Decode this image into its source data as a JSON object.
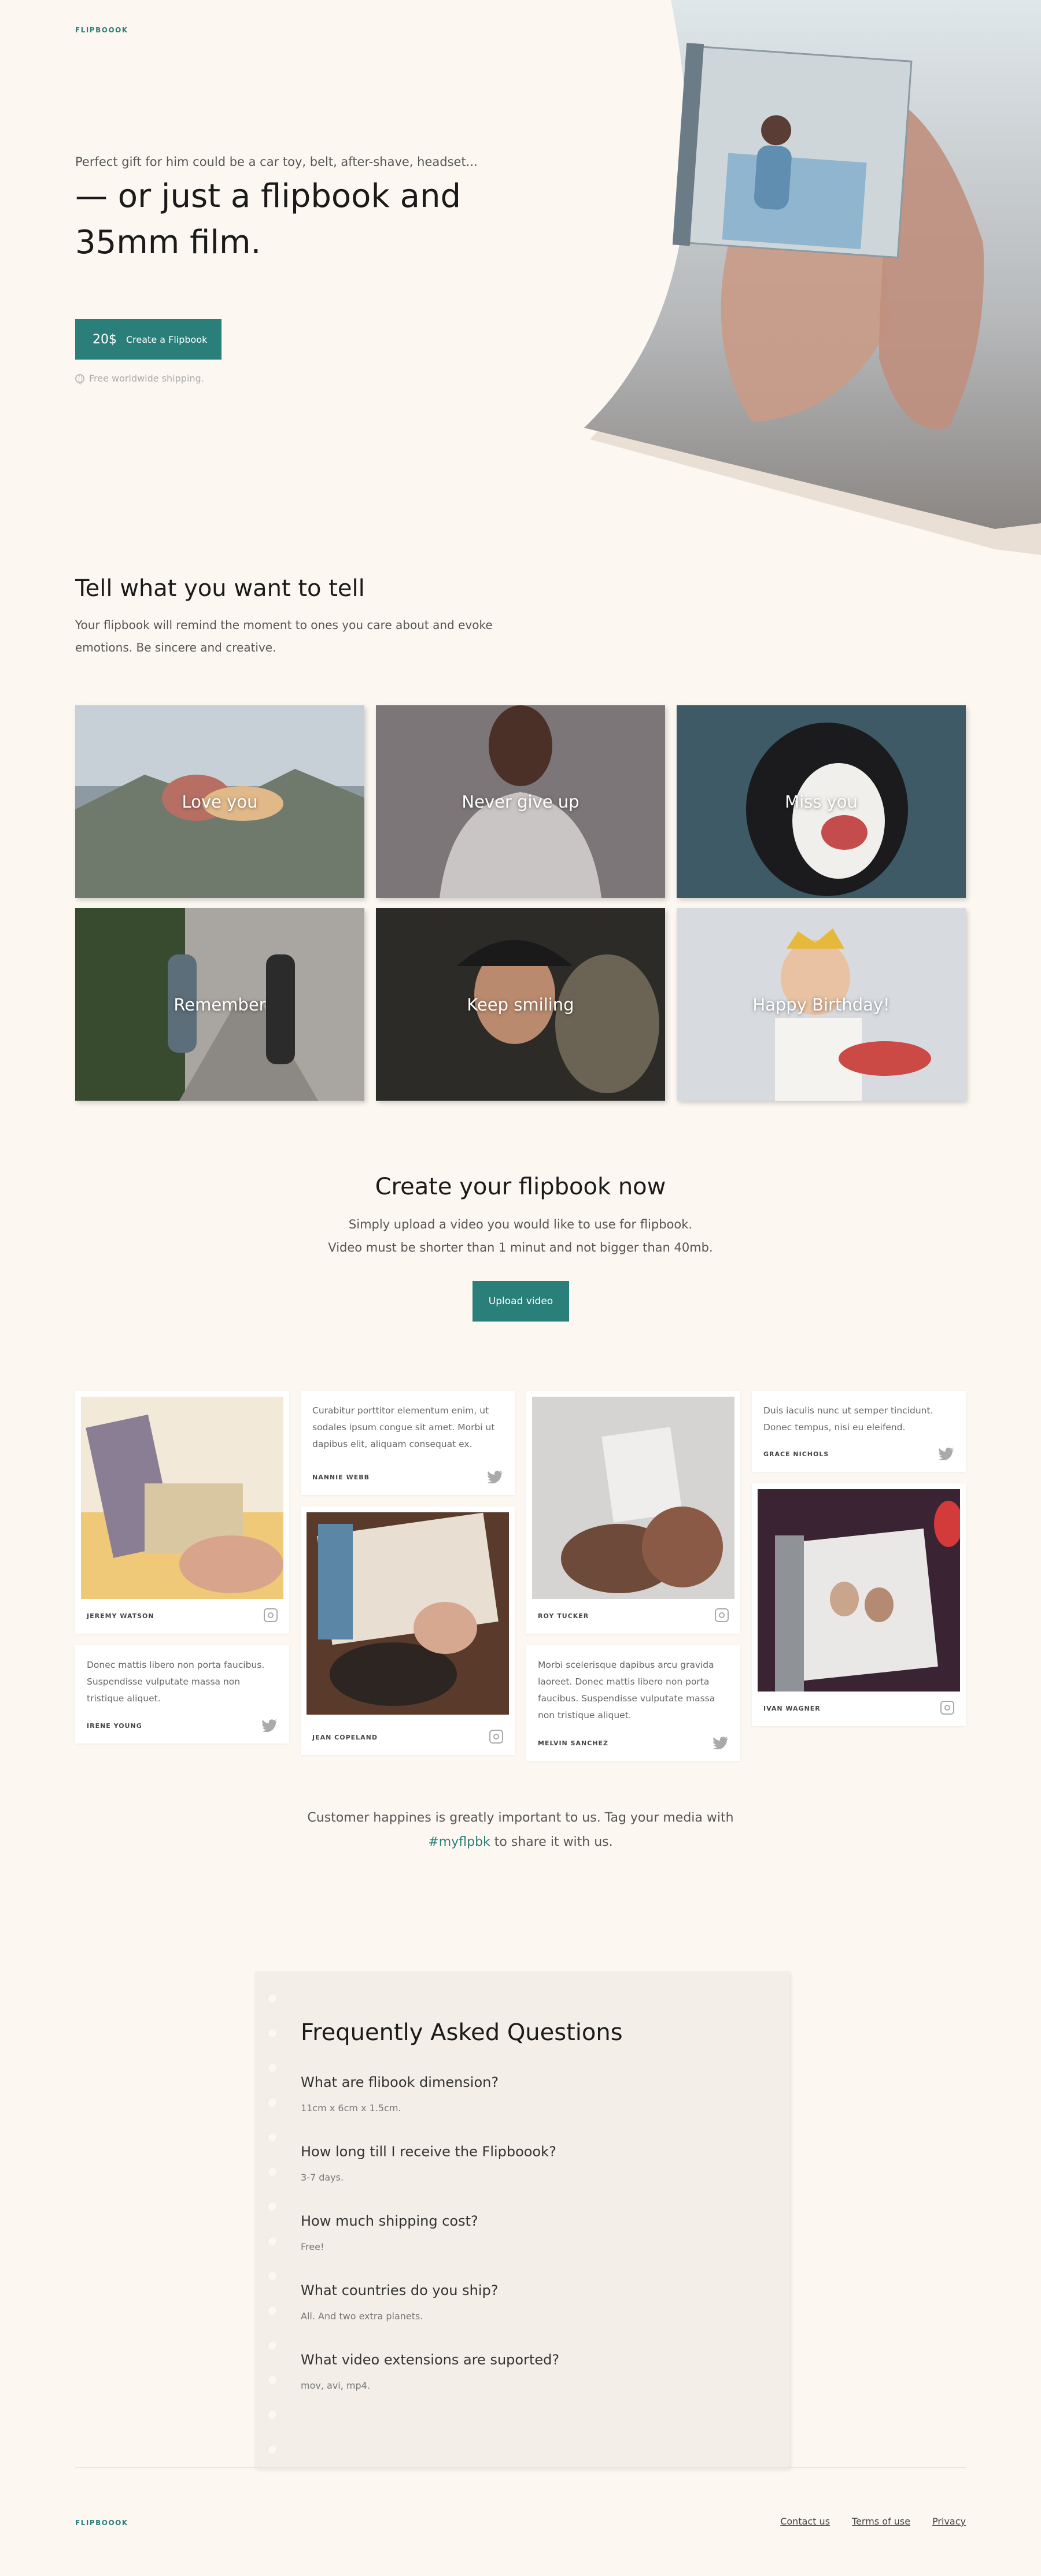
{
  "brand": {
    "logo": "FLIPBOOOK",
    "accent": "#2a7f7a"
  },
  "hero": {
    "eyebrow": "Perfect gift for him could be a car toy, belt, after-shave, headset...",
    "title": "— or just a flipbook and 35mm film.",
    "price": "20$",
    "cta": "Create a Flipbook",
    "shipping": "Free worldwide shipping."
  },
  "tell": {
    "title": "Tell what you want to tell",
    "description": "Your flipbook will remind the moment to ones you care about and evoke emotions. Be sincere and creative.",
    "tiles": [
      {
        "label": "Love you"
      },
      {
        "label": "Never give up"
      },
      {
        "label": "Miss you"
      },
      {
        "label": "Remember"
      },
      {
        "label": "Keep smiling"
      },
      {
        "label": "Happy Birthday!"
      }
    ]
  },
  "create": {
    "title": "Create your flipbook now",
    "line1": "Simply upload a video you would like to use for flipbook.",
    "line2": "Video must be shorter than 1 minut and not bigger than 40mb.",
    "button": "Upload video"
  },
  "reviews": [
    {
      "type": "photo",
      "name": "JEREMY WATSON",
      "icon": "instagram-icon"
    },
    {
      "type": "text",
      "text": "Donec mattis libero non porta faucibus. Suspendisse vulputate massa non tristique aliquet.",
      "name": "IRENE YOUNG",
      "icon": "twitter-icon"
    },
    {
      "type": "text",
      "text": "Curabitur porttitor elementum enim, ut sodales ipsum congue sit amet. Morbi ut dapibus elit, aliquam consequat ex.",
      "name": "NANNIE WEBB",
      "icon": "twitter-icon"
    },
    {
      "type": "photo",
      "name": "JEAN COPELAND",
      "icon": "instagram-icon"
    },
    {
      "type": "photo",
      "name": "ROY TUCKER",
      "icon": "instagram-icon"
    },
    {
      "type": "text",
      "text": "Morbi scelerisque dapibus arcu gravida laoreet. Donec mattis libero non porta faucibus. Suspendisse vulputate massa non tristique aliquet.",
      "name": "MELVIN SANCHEZ",
      "icon": "twitter-icon"
    },
    {
      "type": "text",
      "text": "Duis iaculis nunc ut semper tincidunt. Donec tempus, nisi eu eleifend.",
      "name": "GRACE NICHOLS",
      "icon": "twitter-icon"
    },
    {
      "type": "photo",
      "name": "IVAN WAGNER",
      "icon": "instagram-icon"
    }
  ],
  "tagline": {
    "before": "Customer happines is greatly important to us. Tag your media with",
    "hashtag": "#myflpbk",
    "after": "to share it with us."
  },
  "faq": {
    "title": "Frequently Asked Questions",
    "items": [
      {
        "q": "What are flibook dimension?",
        "a": "11cm x 6cm x 1.5cm."
      },
      {
        "q": "How long till I receive the Flipboook?",
        "a": "3-7 days."
      },
      {
        "q": "How much shipping cost?",
        "a": "Free!"
      },
      {
        "q": "What countries do you ship?",
        "a": "All. And two extra planets."
      },
      {
        "q": "What video extensions are suported?",
        "a": "mov, avi, mp4."
      }
    ]
  },
  "footer": {
    "logo": "FLIPBOOOK",
    "links": [
      "Contact us",
      "Terms of use",
      "Privacy"
    ]
  }
}
